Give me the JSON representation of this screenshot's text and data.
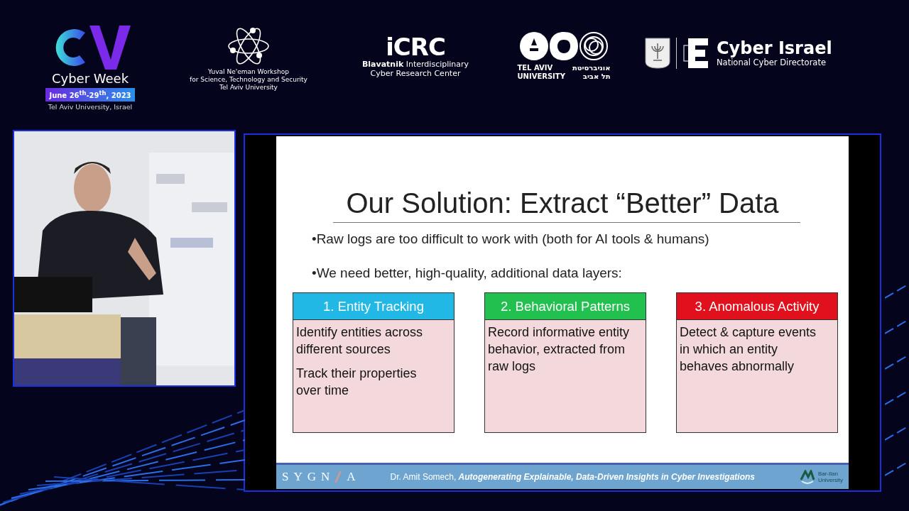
{
  "header": {
    "cyber_week": {
      "title": "Cyber Week",
      "dates": "June 26$^{th}$-29$^{th}$, 2023",
      "location": "Tel Aviv University, Israel"
    },
    "workshop": {
      "lines": [
        "Yuval Ne'eman Workshop",
        "for Science, Technology and Security",
        "Tel Aviv University"
      ]
    },
    "icrc": {
      "acronym": "iCRC",
      "lines": [
        "**Blavatnik** Interdisciplinary",
        "Cyber Research Center"
      ]
    },
    "tau": {
      "english": [
        "TEL AVIV",
        "UNIVERSITY"
      ],
      "hebrew": [
        "אוניברסיטת",
        "תל אביב"
      ]
    },
    "cyber_israel": {
      "title": "Cyber Israel",
      "subtitle": "National Cyber Directorate"
    }
  },
  "slide": {
    "title": "Our Solution: Extract “Better” Data",
    "bullets": [
      "•Raw logs are too difficult to work with (both for AI tools & humans)",
      "•We need better, high-quality, additional data layers:"
    ],
    "cards": [
      {
        "heading": "1. Entity Tracking",
        "color": "#22b8e6",
        "items": [
          "Identify entities across different sources",
          "Track their properties over time"
        ]
      },
      {
        "heading": "2. Behavioral Patterns",
        "color": "#22c04e",
        "items": [
          "Record informative entity behavior, extracted from raw logs"
        ]
      },
      {
        "heading": "3. Anomalous Activity",
        "color": "#e0101c",
        "items": [
          "Detect & capture events in which an entity behaves abnormally"
        ]
      }
    ],
    "footer": {
      "brand_left": "SYGN",
      "brand_right": "A",
      "citation": "Dr. Amit Somech, **Autogenerating Explainable, Data-Driven Insights in Cyber Investigations**",
      "university": [
        "Bar-Ilan",
        "University"
      ]
    }
  }
}
